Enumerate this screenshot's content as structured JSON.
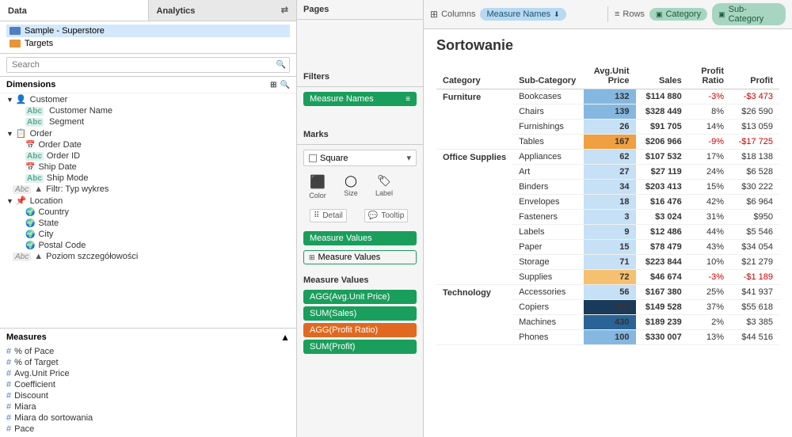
{
  "leftPanel": {
    "tabs": [
      {
        "label": "Data",
        "active": true
      },
      {
        "label": "Analytics",
        "active": false
      }
    ],
    "dataSources": [
      {
        "label": "Sample - Superstore",
        "type": "primary"
      },
      {
        "label": "Targets",
        "type": "secondary"
      }
    ],
    "searchPlaceholder": "Search",
    "dimensions": {
      "header": "Dimensions",
      "groups": [
        {
          "name": "Customer",
          "icon": "folder",
          "items": [
            {
              "label": "Customer Name",
              "iconType": "abc"
            },
            {
              "label": "Segment",
              "iconType": "abc"
            }
          ]
        },
        {
          "name": "Order",
          "icon": "folder",
          "items": [
            {
              "label": "Order Date",
              "iconType": "calendar"
            },
            {
              "label": "Order ID",
              "iconType": "abc"
            },
            {
              "label": "Ship Date",
              "iconType": "calendar"
            },
            {
              "label": "Ship Mode",
              "iconType": "abc"
            }
          ]
        },
        {
          "specialLabel": "Filtr: Typ wykres",
          "iconType": "abc-special"
        },
        {
          "name": "Location",
          "icon": "folder",
          "items": [
            {
              "label": "Country",
              "iconType": "globe"
            },
            {
              "label": "State",
              "iconType": "globe"
            },
            {
              "label": "City",
              "iconType": "globe"
            },
            {
              "label": "Postal Code",
              "iconType": "globe"
            }
          ]
        },
        {
          "specialLabel": "Poziom szczegółowości",
          "iconType": "abc-special"
        }
      ]
    },
    "measures": {
      "header": "Measures",
      "items": [
        {
          "label": "% of Pace"
        },
        {
          "label": "% of Target"
        },
        {
          "label": "Avg.Unit Price"
        },
        {
          "label": "Coefficient"
        },
        {
          "label": "Discount"
        },
        {
          "label": "Miara"
        },
        {
          "label": "Miara do sortowania"
        },
        {
          "label": "Pace"
        }
      ]
    }
  },
  "middlePanel": {
    "pagesHeader": "Pages",
    "filtersHeader": "Filters",
    "filterChip": "Measure Names",
    "marksHeader": "Marks",
    "marksType": "Square",
    "markControls": [
      {
        "label": "Color",
        "icon": "⬛"
      },
      {
        "label": "Size",
        "icon": "◯"
      },
      {
        "label": "Label",
        "icon": "🏷"
      }
    ],
    "markShelves": [
      {
        "icon": "···",
        "label": "Detail"
      },
      {
        "icon": "💬",
        "label": "Tooltip"
      }
    ],
    "measureValuesHeader": "Measure Values",
    "measureChips": [
      {
        "label": "Measure Values",
        "style": "green"
      },
      {
        "label": "Measure Values",
        "style": "green"
      }
    ],
    "measureValueChips": [
      {
        "label": "AGG(Avg.Unit Price)",
        "style": "green"
      },
      {
        "label": "SUM(Sales)",
        "style": "green"
      },
      {
        "label": "AGG(Profit Ratio)",
        "style": "orange"
      },
      {
        "label": "SUM(Profit)",
        "style": "green"
      }
    ]
  },
  "rightPanel": {
    "columns": {
      "label": "Columns",
      "pill": "Measure Names"
    },
    "rows": {
      "label": "Rows",
      "pills": [
        "Category",
        "Sub-Category"
      ]
    },
    "title": "Sortowanie",
    "tableHeaders": [
      {
        "label": "Category"
      },
      {
        "label": "Sub-Category"
      },
      {
        "label": "Avg.Unit Price"
      },
      {
        "label": "Sales"
      },
      {
        "label": "Profit Ratio"
      },
      {
        "label": "Profit"
      }
    ],
    "tableData": [
      {
        "category": "Furniture",
        "rows": [
          {
            "subcat": "Bookcases",
            "avgPrice": 132,
            "avgPriceStyle": "aup-mid",
            "sales": "$114 880",
            "profitRatio": "-3%",
            "profitRatioNeg": true,
            "profit": "-$3 473",
            "profitNeg": true
          },
          {
            "subcat": "Chairs",
            "avgPrice": 139,
            "avgPriceStyle": "aup-mid",
            "sales": "$328 449",
            "profitRatio": "8%",
            "profitRatioNeg": false,
            "profit": "$26 590",
            "profitNeg": false
          },
          {
            "subcat": "Furnishings",
            "avgPrice": 26,
            "avgPriceStyle": "aup-low",
            "sales": "$91 705",
            "profitRatio": "14%",
            "profitRatioNeg": false,
            "profit": "$13 059",
            "profitNeg": false
          },
          {
            "subcat": "Tables",
            "avgPrice": 167,
            "avgPriceStyle": "aup-orange",
            "sales": "$206 966",
            "profitRatio": "-9%",
            "profitRatioNeg": true,
            "profit": "-$17 725",
            "profitNeg": true
          }
        ]
      },
      {
        "category": "Office Supplies",
        "rows": [
          {
            "subcat": "Appliances",
            "avgPrice": 62,
            "avgPriceStyle": "aup-low",
            "sales": "$107 532",
            "profitRatio": "17%",
            "profitRatioNeg": false,
            "profit": "$18 138",
            "profitNeg": false
          },
          {
            "subcat": "Art",
            "avgPrice": 27,
            "avgPriceStyle": "aup-low",
            "sales": "$27 119",
            "profitRatio": "24%",
            "profitRatioNeg": false,
            "profit": "$6 528",
            "profitNeg": false
          },
          {
            "subcat": "Binders",
            "avgPrice": 34,
            "avgPriceStyle": "aup-low",
            "sales": "$203 413",
            "profitRatio": "15%",
            "profitRatioNeg": false,
            "profit": "$30 222",
            "profitNeg": false
          },
          {
            "subcat": "Envelopes",
            "avgPrice": 18,
            "avgPriceStyle": "aup-low",
            "sales": "$16 476",
            "profitRatio": "42%",
            "profitRatioNeg": false,
            "profit": "$6 964",
            "profitNeg": false
          },
          {
            "subcat": "Fasteners",
            "avgPrice": 3,
            "avgPriceStyle": "aup-low",
            "sales": "$3 024",
            "profitRatio": "31%",
            "profitRatioNeg": false,
            "profit": "$950",
            "profitNeg": false
          },
          {
            "subcat": "Labels",
            "avgPrice": 9,
            "avgPriceStyle": "aup-low",
            "sales": "$12 486",
            "profitRatio": "44%",
            "profitRatioNeg": false,
            "profit": "$5 546",
            "profitNeg": false
          },
          {
            "subcat": "Paper",
            "avgPrice": 15,
            "avgPriceStyle": "aup-low",
            "sales": "$78 479",
            "profitRatio": "43%",
            "profitRatioNeg": false,
            "profit": "$34 054",
            "profitNeg": false
          },
          {
            "subcat": "Storage",
            "avgPrice": 71,
            "avgPriceStyle": "aup-low",
            "sales": "$223 844",
            "profitRatio": "10%",
            "profitRatioNeg": false,
            "profit": "$21 279",
            "profitNeg": false
          },
          {
            "subcat": "Supplies",
            "avgPrice": 72,
            "avgPriceStyle": "aup-lightorange",
            "sales": "$46 674",
            "profitRatio": "-3%",
            "profitRatioNeg": true,
            "profit": "-$1 189",
            "profitNeg": true
          }
        ]
      },
      {
        "category": "Technology",
        "rows": [
          {
            "subcat": "Accessories",
            "avgPrice": 56,
            "avgPriceStyle": "aup-low",
            "sales": "$167 380",
            "profitRatio": "25%",
            "profitRatioNeg": false,
            "profit": "$41 937",
            "profitNeg": false
          },
          {
            "subcat": "Copiers",
            "avgPrice": 639,
            "avgPriceStyle": "aup-vhigh",
            "sales": "$149 528",
            "profitRatio": "37%",
            "profitRatioNeg": false,
            "profit": "$55 618",
            "profitNeg": false
          },
          {
            "subcat": "Machines",
            "avgPrice": 430,
            "avgPriceStyle": "aup-high",
            "sales": "$189 239",
            "profitRatio": "2%",
            "profitRatioNeg": false,
            "profit": "$3 385",
            "profitNeg": false
          },
          {
            "subcat": "Phones",
            "avgPrice": 100,
            "avgPriceStyle": "aup-mid",
            "sales": "$330 007",
            "profitRatio": "13%",
            "profitRatioNeg": false,
            "profit": "$44 516",
            "profitNeg": false
          }
        ]
      }
    ]
  }
}
